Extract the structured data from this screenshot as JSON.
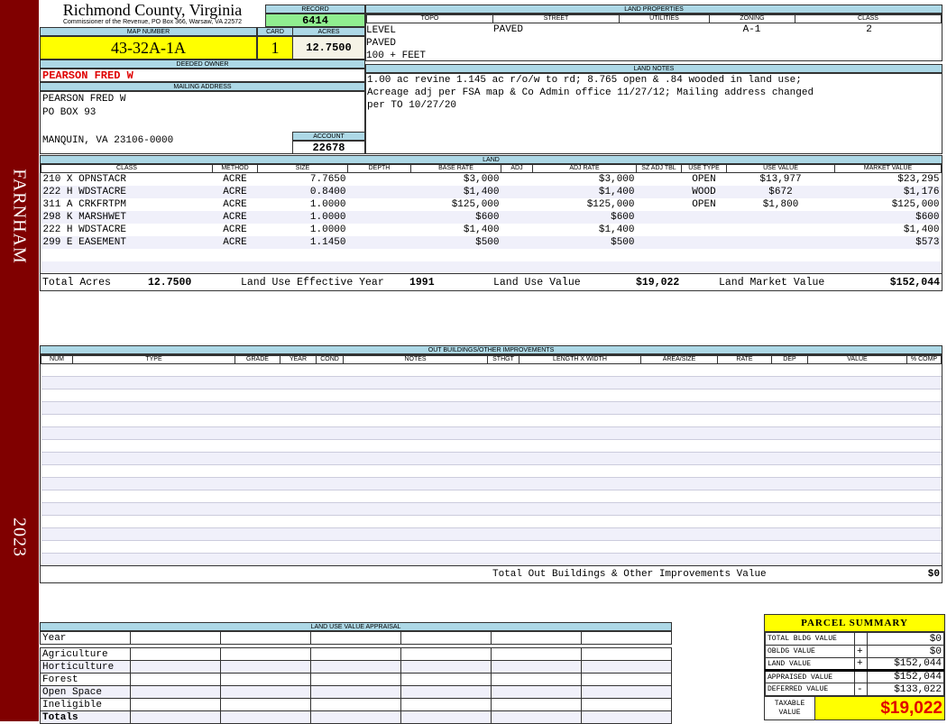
{
  "sidebar": {
    "district": "FARNHAM",
    "year": "2023"
  },
  "header": {
    "title": "Richmond County, Virginia",
    "subtitle": "Commissioner of the Revenue, PO Box 366, Warsaw, VA 22572",
    "record_label": "RECORD",
    "record": "6414",
    "map_label": "MAP NUMBER",
    "map_number": "43-32A-1A",
    "card_label": "CARD",
    "card": "1",
    "acres_label": "ACRES",
    "acres": "12.7500"
  },
  "owner": {
    "deeded_label": "DEEDED OWNER",
    "deeded": "PEARSON FRED W",
    "mailing_label": "MAILING ADDRESS",
    "line1": "PEARSON FRED W",
    "line2": "PO BOX 93",
    "line3": "MANQUIN, VA 23106-0000",
    "account_label": "ACCOUNT",
    "account": "22678"
  },
  "land_properties": {
    "title": "LAND PROPERTIES",
    "headers": [
      "TOPO",
      "STREET",
      "UTILITIES",
      "ZONING",
      "CLASS"
    ],
    "topo": [
      "LEVEL",
      "PAVED",
      "100 + FEET"
    ],
    "street": "PAVED",
    "zoning": "A-1",
    "class": "2"
  },
  "land_notes": {
    "title": "LAND NOTES",
    "lines": [
      "1.00 ac revine 1.145 ac r/o/w to rd; 8.765 open & .84 wooded in land use;",
      "Acreage adj per FSA map & Co Admin office 11/27/12; Mailing address changed",
      "per TO 10/27/20"
    ]
  },
  "land": {
    "title": "LAND",
    "headers": [
      "CLASS",
      "METHOD",
      "SIZE",
      "DEPTH",
      "BASE RATE",
      "ADJ",
      "ADJ RATE",
      "SZ ADJ TBL",
      "USE TYPE",
      "USE VALUE",
      "MARKET VALUE"
    ],
    "rows": [
      [
        "210 X OPNSTACR",
        "ACRE",
        "7.7650",
        "",
        "$3,000",
        "",
        "$3,000",
        "",
        "OPEN",
        "$13,977",
        "$23,295"
      ],
      [
        "222 H WDSTACRE",
        "ACRE",
        "0.8400",
        "",
        "$1,400",
        "",
        "$1,400",
        "",
        "WOOD",
        "$672",
        "$1,176"
      ],
      [
        "311 A CRKFRTPM",
        "ACRE",
        "1.0000",
        "",
        "$125,000",
        "",
        "$125,000",
        "",
        "OPEN",
        "$1,800",
        "$125,000"
      ],
      [
        "298 K MARSHWET",
        "ACRE",
        "1.0000",
        "",
        "$600",
        "",
        "$600",
        "",
        "",
        "",
        "$600"
      ],
      [
        "222 H WDSTACRE",
        "ACRE",
        "1.0000",
        "",
        "$1,400",
        "",
        "$1,400",
        "",
        "",
        "",
        "$1,400"
      ],
      [
        "299 E EASEMENT",
        "ACRE",
        "1.1450",
        "",
        "$500",
        "",
        "$500",
        "",
        "",
        "",
        "$573"
      ],
      [
        "",
        "",
        "",
        "",
        "",
        "",
        "",
        "",
        "",
        "",
        ""
      ],
      [
        "",
        "",
        "",
        "",
        "",
        "",
        "",
        "",
        "",
        "",
        ""
      ]
    ],
    "total_acres_label": "Total Acres",
    "total_acres": "12.7500",
    "eff_year_label": "Land Use Effective Year",
    "eff_year": "1991",
    "use_value_label": "Land Use Value",
    "use_value": "$19,022",
    "market_value_label": "Land Market Value",
    "market_value": "$152,044"
  },
  "outbuildings": {
    "title": "OUT BUILDINGS/OTHER IMPROVEMENTS",
    "headers": [
      "NUM",
      "TYPE",
      "GRADE",
      "YEAR",
      "COND",
      "NOTES",
      "STHGT",
      "LENGTH X WIDTH",
      "AREA/SIZE",
      "RATE",
      "DEP",
      "VALUE",
      "% COMP"
    ],
    "total_label": "Total Out Buildings & Other Improvements Value",
    "total": "$0"
  },
  "land_use": {
    "title": "LAND USE VALUE APPRAISAL",
    "year_label": "Year",
    "rows": [
      "Agriculture",
      "Horticulture",
      "Forest",
      "Open Space",
      "Ineligible"
    ],
    "totals_label": "Totals"
  },
  "parcel_summary": {
    "title": "PARCEL SUMMARY",
    "rows": [
      {
        "label": "TOTAL BLDG VALUE",
        "sign": "",
        "value": "$0"
      },
      {
        "label": "OBLDG VALUE",
        "sign": "+",
        "value": "$0"
      },
      {
        "label": "LAND VALUE",
        "sign": "+",
        "value": "$152,044"
      },
      {
        "label": "APPRAISED VALUE",
        "sign": "",
        "value": "$152,044"
      },
      {
        "label": "DEFERRED VALUE",
        "sign": "-",
        "value": "$133,022"
      }
    ],
    "taxable_label": "TAXABLE VALUE",
    "taxable": "$19,022"
  }
}
